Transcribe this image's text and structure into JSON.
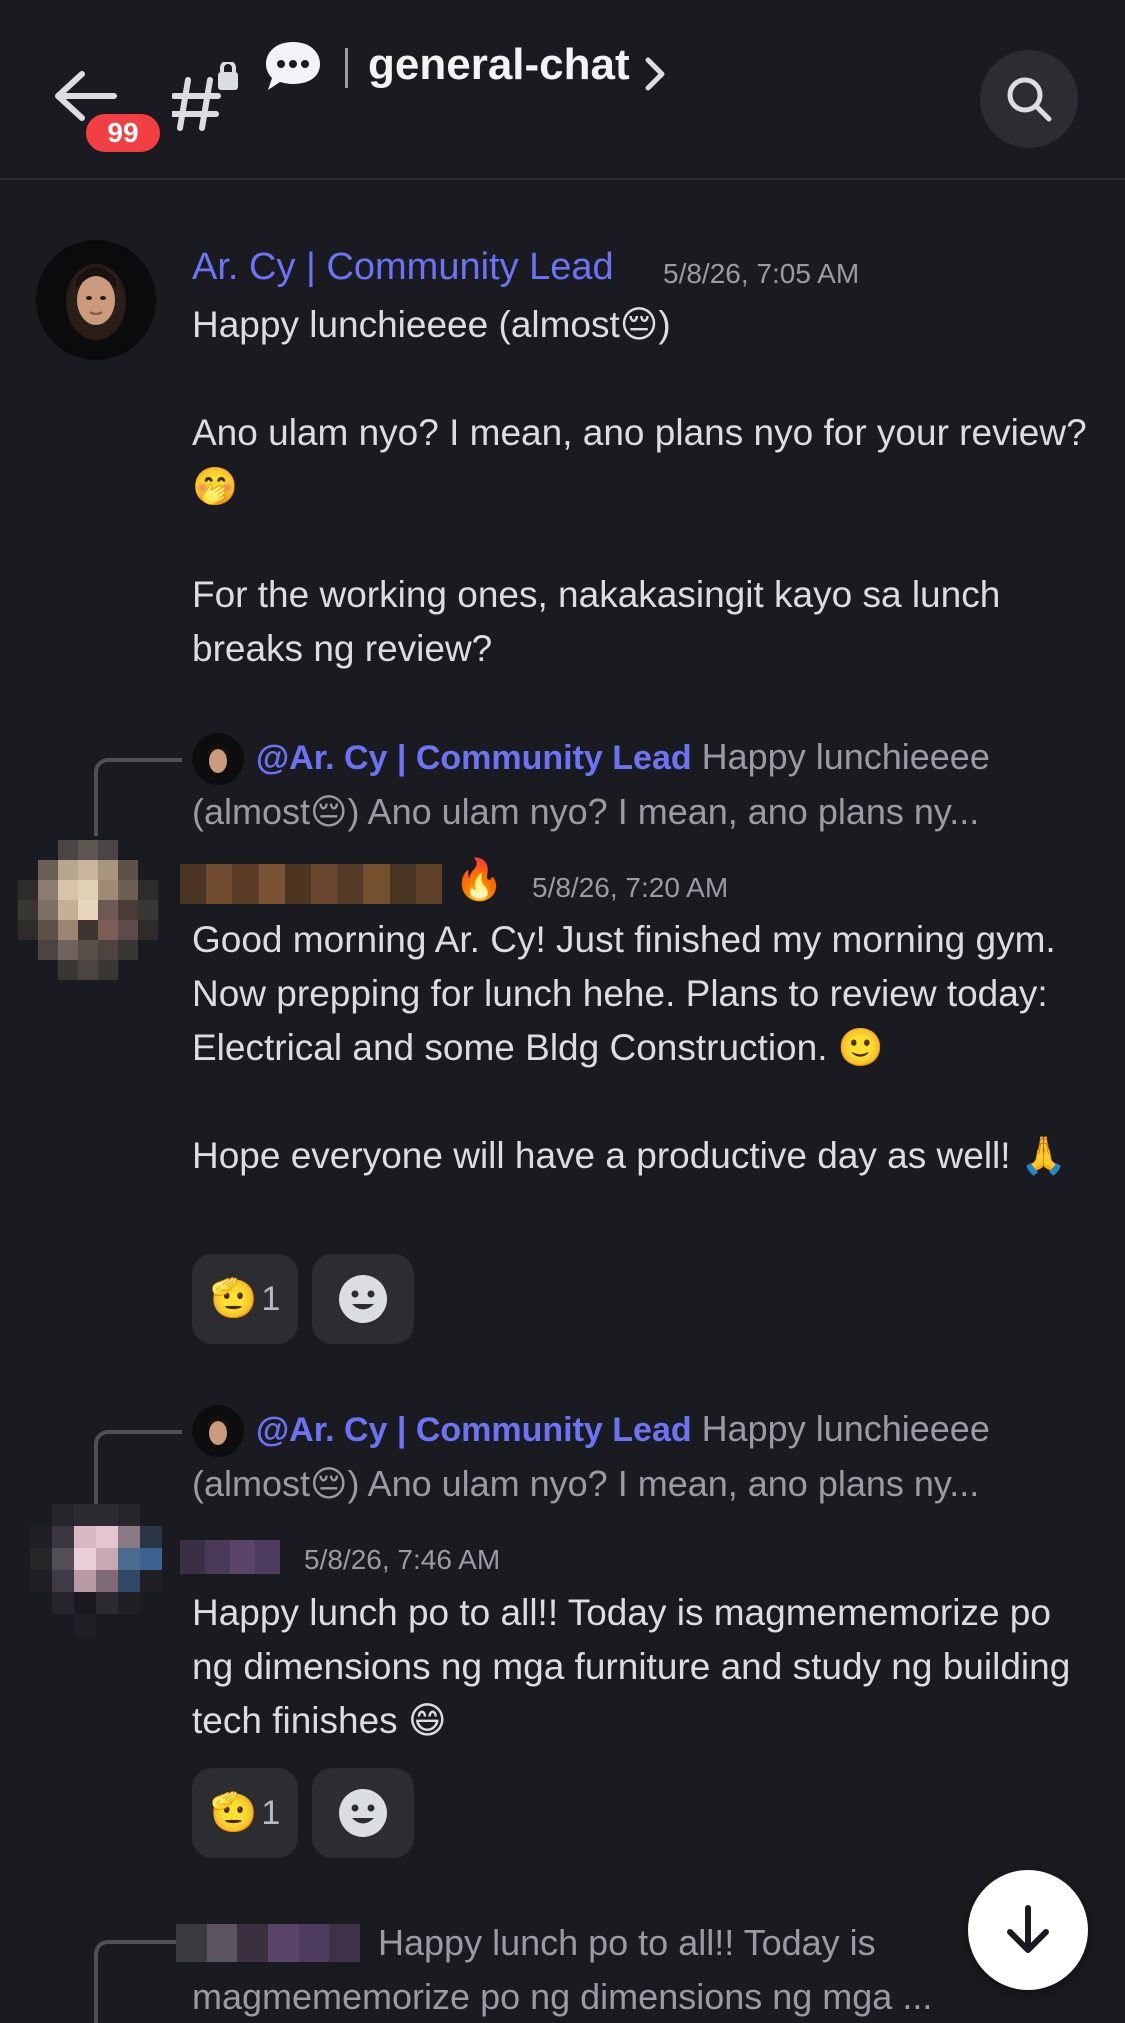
{
  "header": {
    "unread_count": "99",
    "channel_name": "general-chat",
    "icons": [
      "back-arrow-icon",
      "locked-channel-icon",
      "threads-icon",
      "chevron-right-icon",
      "search-icon"
    ]
  },
  "colors": {
    "background": "#1a1b20",
    "mention": "#6c74f5",
    "badge": "#f23f43",
    "muted": "#9a9ba3",
    "text": "#dbdee1"
  },
  "messages": [
    {
      "author": "Ar. Cy | Community Lead",
      "timestamp": "5/8/26, 7:05 AM",
      "paragraphs": [
        "Happy lunchieeee (almost😔)",
        "",
        "Ano ulam nyo? I mean, ano plans nyo for your review? 🤭",
        "",
        "For the working ones, nakakasingit kayo sa lunch breaks ng review?"
      ]
    },
    {
      "reply_to": {
        "mention": "@Ar. Cy | Community Lead",
        "preview": "Happy lunchieeee (almost😔)  Ano ulam nyo? I mean, ano plans ny..."
      },
      "author_badge": "🔥",
      "timestamp": "5/8/26, 7:20 AM",
      "paragraphs": [
        "Good morning Ar. Cy! Just finished my morning gym. Now prepping for lunch hehe. Plans to review today: Electrical and some Bldg Construction. 🙂",
        "",
        "Hope everyone will have a productive day as well! 🙏"
      ],
      "reactions": [
        {
          "emoji": "🫡",
          "count": "1"
        }
      ]
    },
    {
      "reply_to": {
        "mention": "@Ar. Cy | Community Lead",
        "preview": "Happy lunchieeee (almost😔)  Ano ulam nyo? I mean, ano plans ny..."
      },
      "timestamp": "5/8/26, 7:46 AM",
      "paragraphs": [
        "Happy lunch po to all!! Today is magmememorize po ng dimensions ng mga furniture and study ng building tech finishes 😄"
      ],
      "reactions": [
        {
          "emoji": "🫡",
          "count": "1"
        }
      ]
    },
    {
      "reply_to": {
        "preview": "Happy lunch po to all!! Today is magmememorize po ng dimensions ng mga ..."
      }
    }
  ]
}
